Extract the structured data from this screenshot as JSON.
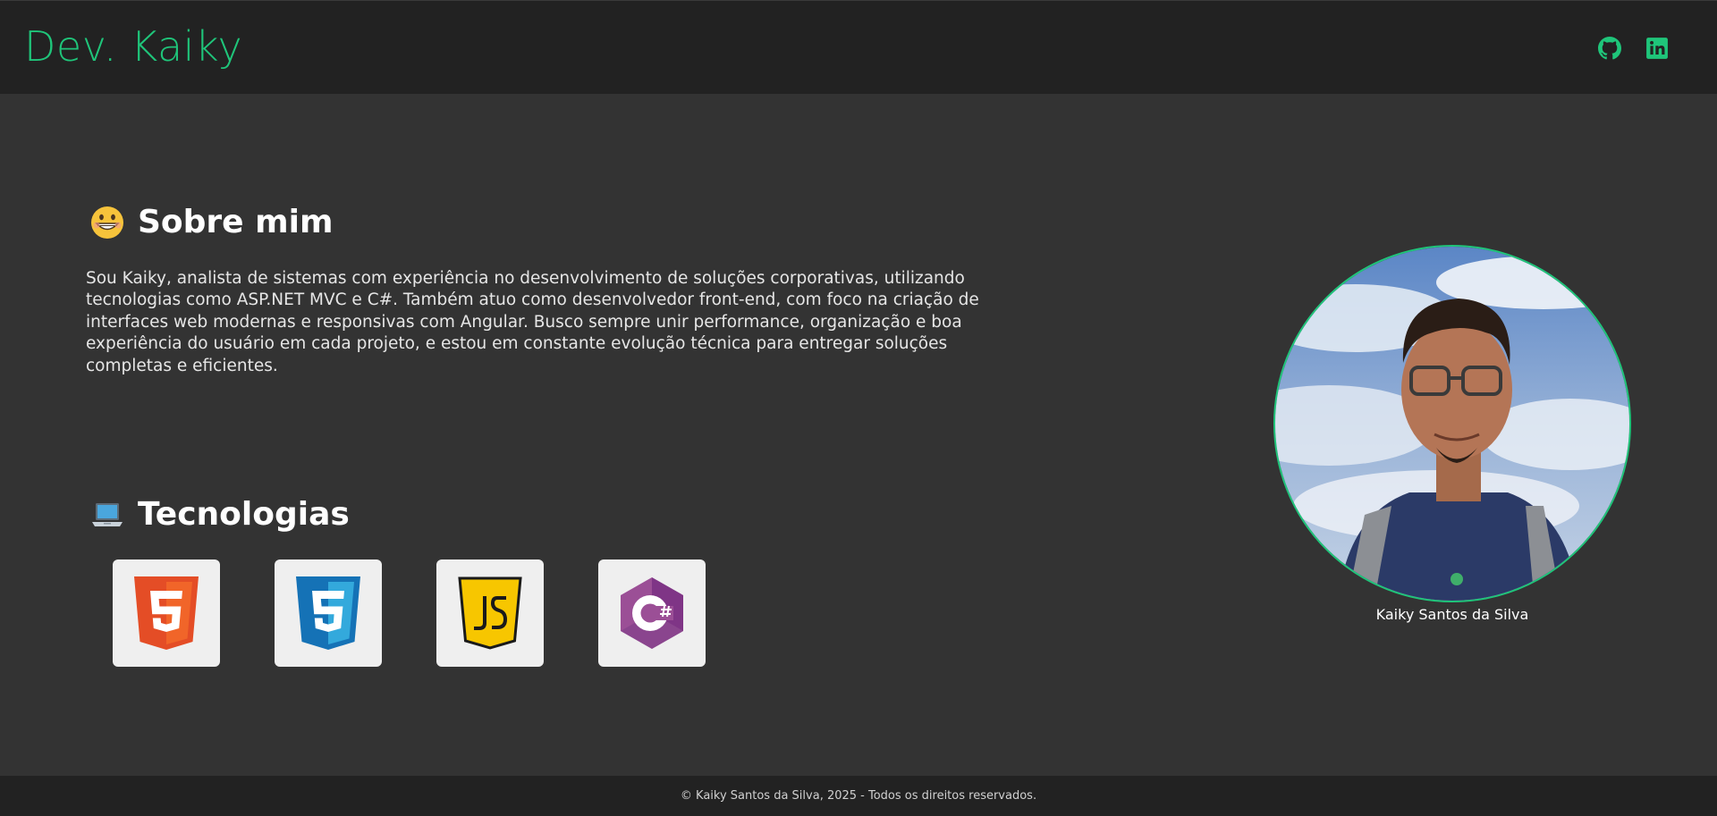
{
  "header": {
    "brand": "Dev. Kaiky",
    "social": [
      {
        "icon": "github-icon",
        "color": "#1fc57a"
      },
      {
        "icon": "linkedin-icon",
        "color": "#1fc57a"
      }
    ]
  },
  "about": {
    "emoji": "grinning-face-icon",
    "title": "Sobre mim",
    "text": "Sou Kaiky, analista de sistemas com experiência no desenvolvimento de soluções corporativas, utilizando tecnologias como ASP.NET MVC e C#. Também atuo como desenvolvedor front-end, com foco na criação de interfaces web modernas e responsivas com Angular. Busco sempre unir performance, organização e boa experiência do usuário em cada projeto, e estou em constante evolução técnica para entregar soluções completas e eficientes."
  },
  "tech": {
    "emoji": "laptop-icon",
    "title": "Tecnologias",
    "items": [
      {
        "icon": "html5-icon",
        "color": "#e44d26"
      },
      {
        "icon": "css3-icon",
        "color": "#1572b6"
      },
      {
        "icon": "javascript-icon",
        "color": "#f7c600"
      },
      {
        "icon": "csharp-icon",
        "color": "#9b4f96"
      }
    ]
  },
  "profile": {
    "name": "Kaiky Santos da Silva"
  },
  "footer": {
    "text": "© Kaiky Santos da Silva, 2025 - Todos os direitos reservados."
  },
  "colors": {
    "accent": "#1fc57a",
    "background": "#333333",
    "bar": "#222222"
  }
}
